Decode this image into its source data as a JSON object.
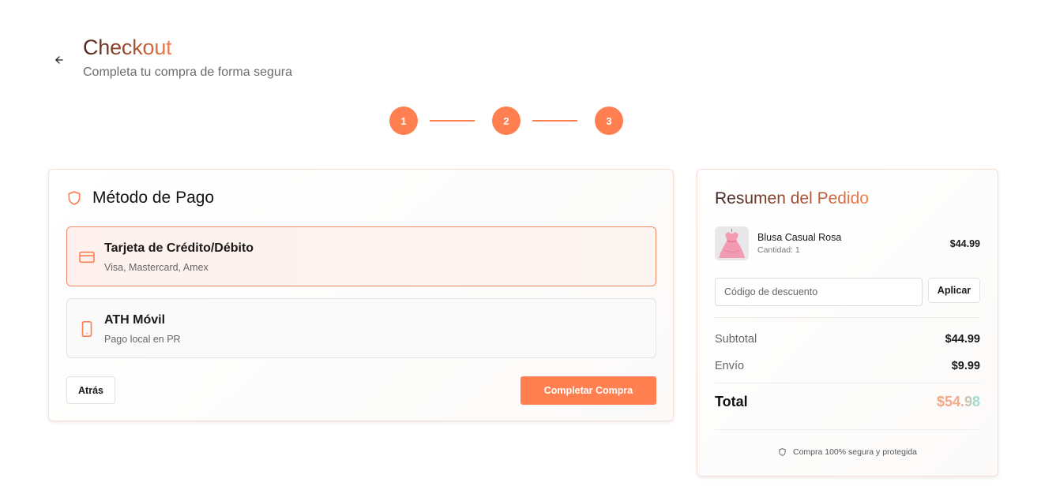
{
  "header": {
    "title": "Checkout",
    "subtitle": "Completa tu compra de forma segura"
  },
  "stepper": {
    "steps": [
      "1",
      "2",
      "3"
    ],
    "current_step": 3
  },
  "payment": {
    "title": "Método de Pago",
    "options": [
      {
        "icon": "credit-card-icon",
        "title": "Tarjeta de Crédito/Débito",
        "subtitle": "Visa, Mastercard, Amex",
        "selected": true
      },
      {
        "icon": "smartphone-icon",
        "title": "ATH Móvil",
        "subtitle": "Pago local en PR",
        "selected": false
      }
    ],
    "back_label": "Atrás",
    "complete_label": "Completar Compra"
  },
  "summary": {
    "title": "Resumen del Pedido",
    "items": [
      {
        "name": "Blusa Casual Rosa",
        "quantity": "Cantidad: 1",
        "price": "$44.99"
      }
    ],
    "discount": {
      "placeholder": "Código de descuento",
      "value": "",
      "apply_label": "Aplicar"
    },
    "subtotal_label": "Subtotal",
    "subtotal_value": "$44.99",
    "shipping_label": "Envío",
    "shipping_value": "$9.99",
    "total_label": "Total",
    "total_value": "$54.98",
    "secure_note": "Compra 100% segura y protegida"
  },
  "colors": {
    "accent": "#ff7f50",
    "selected_border": "#f08a66",
    "card_border": "#f6ded6"
  }
}
